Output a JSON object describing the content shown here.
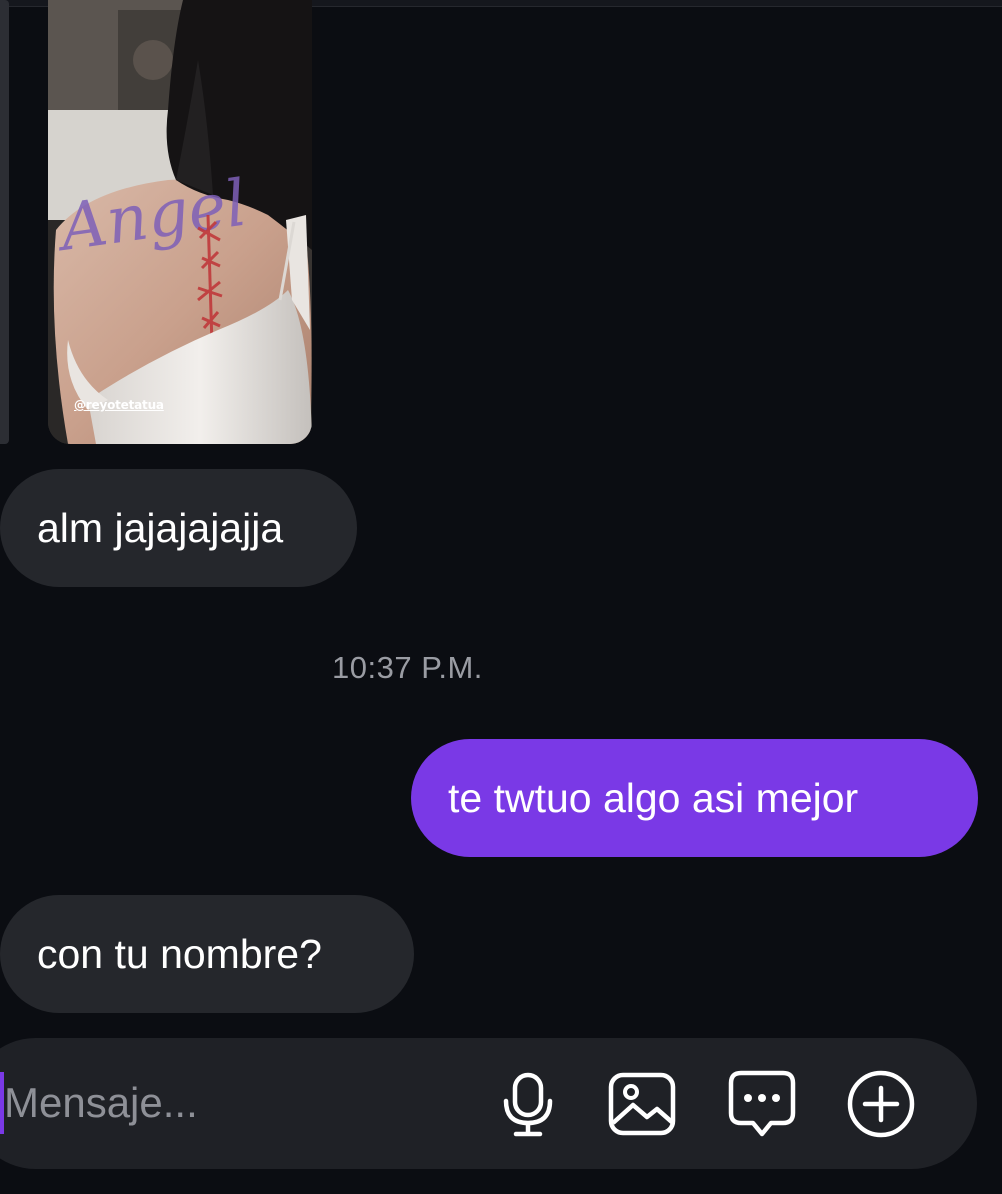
{
  "photo": {
    "watermark": "@reyotetatua",
    "tattoo_text": "Angel"
  },
  "messages": [
    {
      "direction": "incoming",
      "text": "alm jajajajajja"
    },
    {
      "direction": "outgoing",
      "text": "te twtuo algo asi mejor"
    },
    {
      "direction": "incoming",
      "text": "con tu nombre?"
    }
  ],
  "timestamp": "10:37 P.M.",
  "composer": {
    "placeholder": "Mensaje...",
    "icons": [
      "microphone-icon",
      "image-icon",
      "message-icon",
      "plus-circle-icon"
    ]
  },
  "colors": {
    "background": "#0b0d12",
    "incoming_bubble": "#25272c",
    "outgoing_bubble": "#7a39e6",
    "composer": "#1f2126",
    "timestamp": "#9a9ca3"
  }
}
